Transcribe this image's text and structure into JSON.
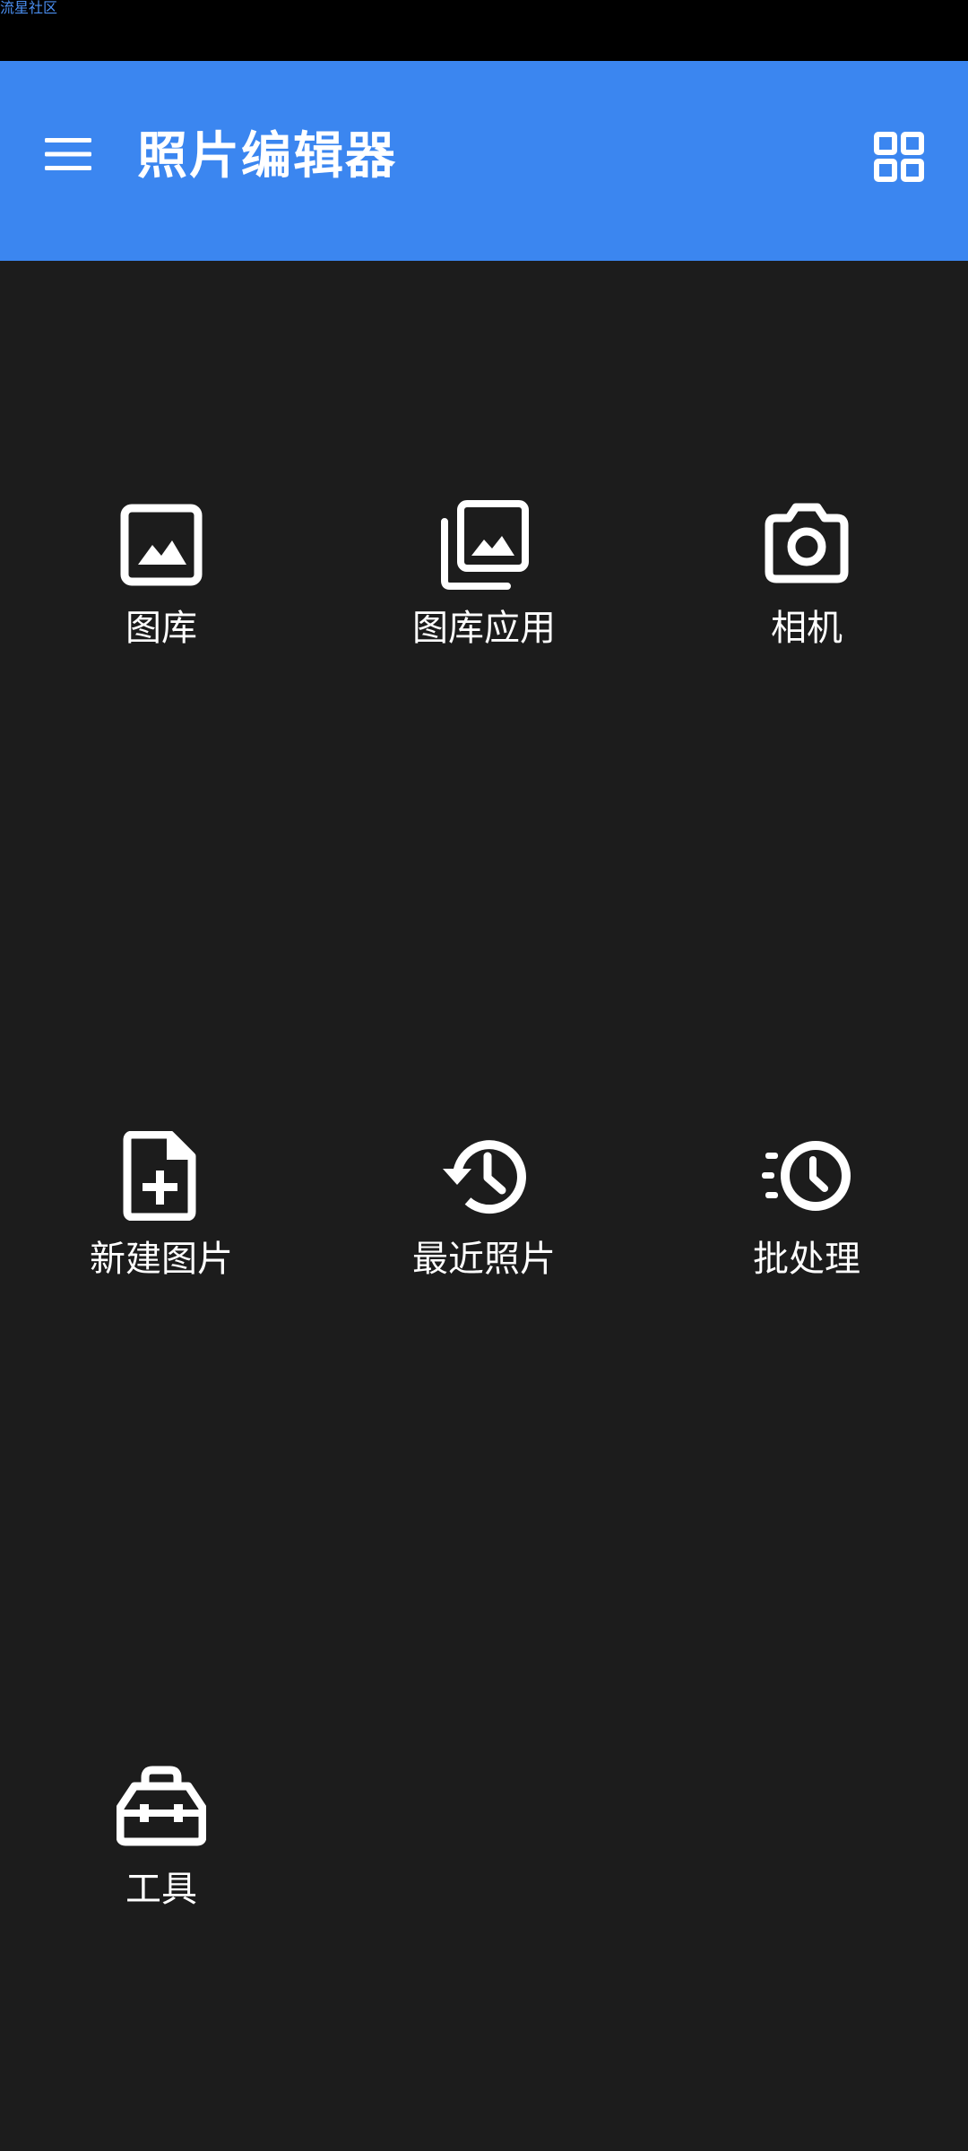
{
  "status_bar": {
    "watermark": "流星社区"
  },
  "app_bar": {
    "title": "照片编辑器",
    "menu_icon": "hamburger-menu-icon",
    "view_icon": "grid-view-icon",
    "background": "#3b86f0"
  },
  "tiles": [
    {
      "label": "图库",
      "icon": "image-icon"
    },
    {
      "label": "图库应用",
      "icon": "photo-library-icon"
    },
    {
      "label": "相机",
      "icon": "camera-icon"
    },
    {
      "label": "新建图片",
      "icon": "new-file-icon"
    },
    {
      "label": "最近照片",
      "icon": "history-icon"
    },
    {
      "label": "批处理",
      "icon": "batch-clock-icon"
    },
    {
      "label": "工具",
      "icon": "toolbox-icon"
    }
  ],
  "colors": {
    "background": "#1c1c1c",
    "status_bar": "#000000",
    "text": "#ffffff"
  }
}
